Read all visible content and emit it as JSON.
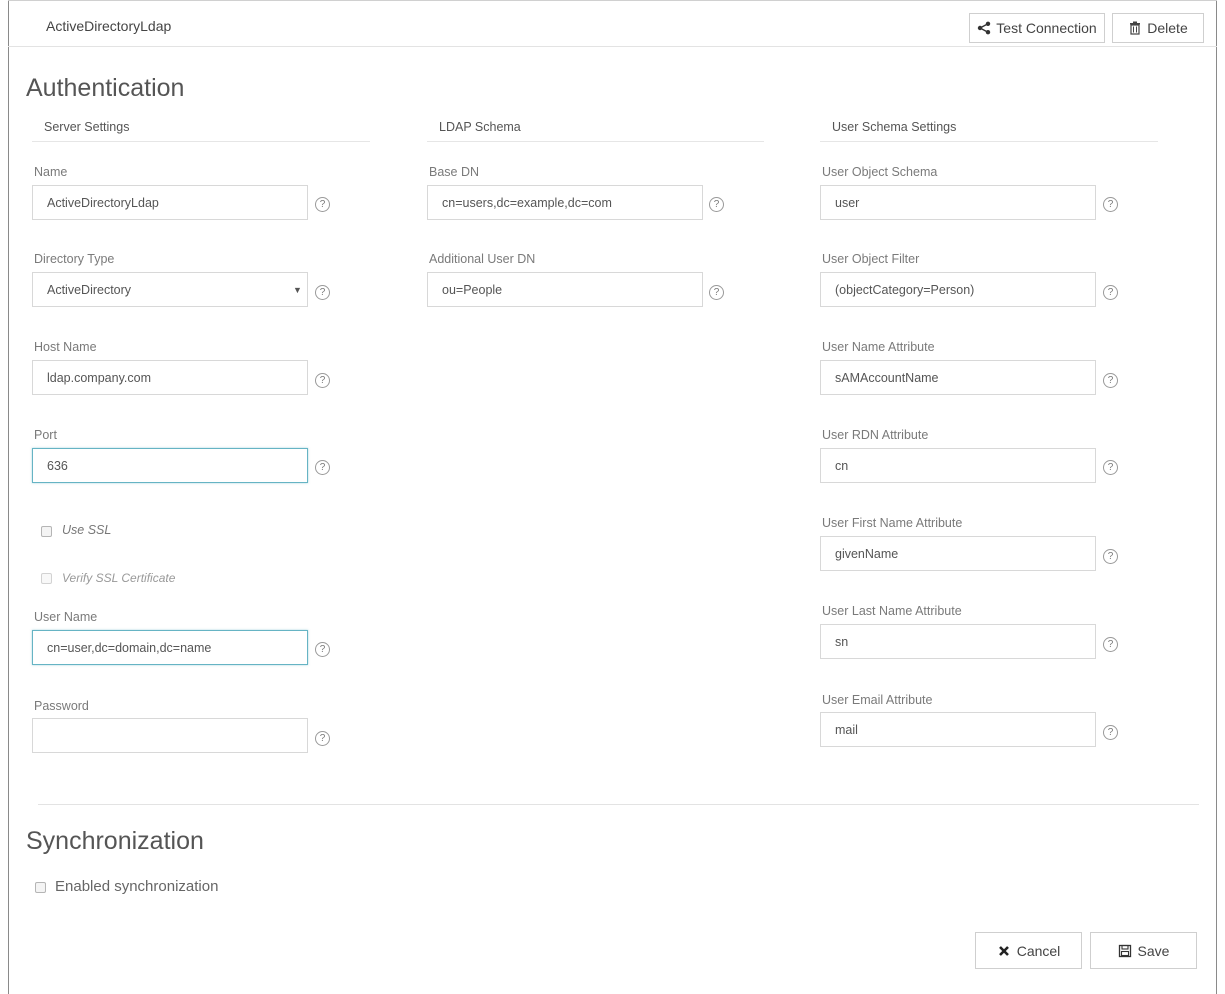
{
  "header": {
    "title": "ActiveDirectoryLdap",
    "test_connection_label": "Test Connection",
    "delete_label": "Delete"
  },
  "authentication": {
    "title": "Authentication",
    "columns": {
      "server": "Server Settings",
      "ldap": "LDAP Schema",
      "user_schema": "User Schema Settings"
    },
    "server": {
      "name": {
        "label": "Name",
        "value": "ActiveDirectoryLdap"
      },
      "directory_type": {
        "label": "Directory Type",
        "value": "ActiveDirectory"
      },
      "host_name": {
        "label": "Host Name",
        "value": "ldap.company.com"
      },
      "port": {
        "label": "Port",
        "value": "636"
      },
      "use_ssl": {
        "label": "Use SSL",
        "checked": false
      },
      "verify_ssl": {
        "label": "Verify SSL Certificate",
        "checked": false
      },
      "user_name": {
        "label": "User Name",
        "value": "cn=user,dc=domain,dc=name"
      },
      "password": {
        "label": "Password",
        "value": ""
      }
    },
    "ldap": {
      "base_dn": {
        "label": "Base DN",
        "value": "cn=users,dc=example,dc=com"
      },
      "additional_user_dn": {
        "label": "Additional User DN",
        "value": "ou=People"
      }
    },
    "user_schema": {
      "object_schema": {
        "label": "User Object Schema",
        "value": "user"
      },
      "object_filter": {
        "label": "User Object Filter",
        "value": "(objectCategory=Person)"
      },
      "name_attr": {
        "label": "User Name Attribute",
        "value": "sAMAccountName"
      },
      "rdn_attr": {
        "label": "User RDN Attribute",
        "value": "cn"
      },
      "first_name_attr": {
        "label": "User First Name Attribute",
        "value": "givenName"
      },
      "last_name_attr": {
        "label": "User Last Name Attribute",
        "value": "sn"
      },
      "email_attr": {
        "label": "User Email Attribute",
        "value": "mail"
      }
    }
  },
  "synchronization": {
    "title": "Synchronization",
    "enabled_label": "Enabled synchronization",
    "enabled": false
  },
  "footer": {
    "cancel_label": "Cancel",
    "save_label": "Save"
  },
  "help_glyph": "?"
}
